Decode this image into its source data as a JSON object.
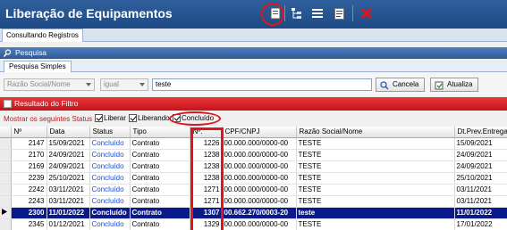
{
  "window": {
    "title": "Liberação de Equipamentos"
  },
  "toolbar": {
    "icons": [
      "document-icon",
      "tree-icon",
      "menu-icon",
      "report-icon",
      "close-icon"
    ],
    "colors": {
      "close": "#e0151b",
      "annotation": "#e0151b"
    }
  },
  "main_tab": {
    "label": "Consultando Registros"
  },
  "search": {
    "header": "Pesquisa",
    "tab": "Pesquisa Simples",
    "field_select": "Razão Social/Nome",
    "operator_select": "igual",
    "query": "teste",
    "cancel_label": "Cancela",
    "update_label": "Atualiza"
  },
  "result": {
    "header": "Resultado do Filtro",
    "status_label": "Mostrar os seguintes Status :",
    "status_options": [
      "Liberar",
      "Liberando",
      "Concluído"
    ]
  },
  "table": {
    "columns": [
      "Nº",
      "Data",
      "Status",
      "Tipo",
      "Nº.",
      "CPF/CNPJ",
      "Razão Social/Nome",
      "Dt.Prev.Entrega"
    ],
    "rows": [
      [
        "2147",
        "15/09/2021",
        "Concluído",
        "Contrato",
        "1226",
        "00.000.000/0000-00",
        "TESTE",
        "15/09/2021"
      ],
      [
        "2170",
        "24/09/2021",
        "Concluído",
        "Contrato",
        "1238",
        "00.000.000/0000-00",
        "TESTE",
        "24/09/2021"
      ],
      [
        "2169",
        "24/09/2021",
        "Concluído",
        "Contrato",
        "1238",
        "00.000.000/0000-00",
        "TESTE",
        "24/09/2021"
      ],
      [
        "2239",
        "25/10/2021",
        "Concluído",
        "Contrato",
        "1238",
        "00.000.000/0000-00",
        "TESTE",
        "25/10/2021"
      ],
      [
        "2242",
        "03/11/2021",
        "Concluído",
        "Contrato",
        "1271",
        "00.000.000/0000-00",
        "TESTE",
        "03/11/2021"
      ],
      [
        "2243",
        "03/11/2021",
        "Concluído",
        "Contrato",
        "1271",
        "00.000.000/0000-00",
        "TESTE",
        "03/11/2021"
      ],
      [
        "2300",
        "11/01/2022",
        "Concluído",
        "Contrato",
        "1307",
        "00.662.270/0003-20",
        "teste",
        "11/01/2022"
      ],
      [
        "2345",
        "01/12/2021",
        "Concluído",
        "Contrato",
        "1329",
        "00.000.000/0000-00",
        "TESTE",
        "17/01/2022"
      ]
    ],
    "selected_row": 6
  }
}
